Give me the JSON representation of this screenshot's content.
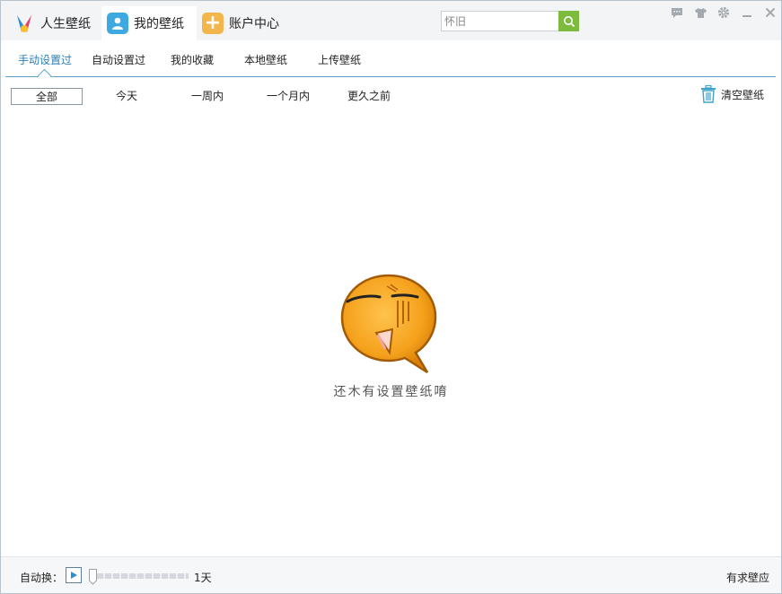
{
  "titlebar": {
    "tabs": [
      {
        "label": "人生壁纸",
        "icon": "app-logo-icon"
      },
      {
        "label": "我的壁纸",
        "icon": "user-icon"
      },
      {
        "label": "账户中心",
        "icon": "plus-icon"
      }
    ],
    "search": {
      "value": "怀旧",
      "icon": "search-icon"
    },
    "controls": [
      "message-icon",
      "skin-icon",
      "settings-icon",
      "minimize-icon",
      "close-icon"
    ]
  },
  "subnav": {
    "items": [
      "手动设置过",
      "自动设置过",
      "我的收藏",
      "本地壁纸",
      "上传壁纸"
    ],
    "active": "手动设置过"
  },
  "filters": {
    "items": [
      "全部",
      "今天",
      "一周内",
      "一个月内",
      "更久之前"
    ],
    "active": "全部"
  },
  "clear_button": {
    "label": "清空壁纸",
    "icon": "trash-icon"
  },
  "empty_state": {
    "text": "还木有设置壁纸唷",
    "icon": "sad-face-bubble-icon"
  },
  "footer": {
    "auto_change_label": "自动换：",
    "interval": "1天",
    "slider_level": 0,
    "right_link": "有求壁应"
  },
  "colors": {
    "accent_blue": "#2a7fb5",
    "search_green": "#7cbb3d",
    "face_orange": "#f5a11c"
  }
}
